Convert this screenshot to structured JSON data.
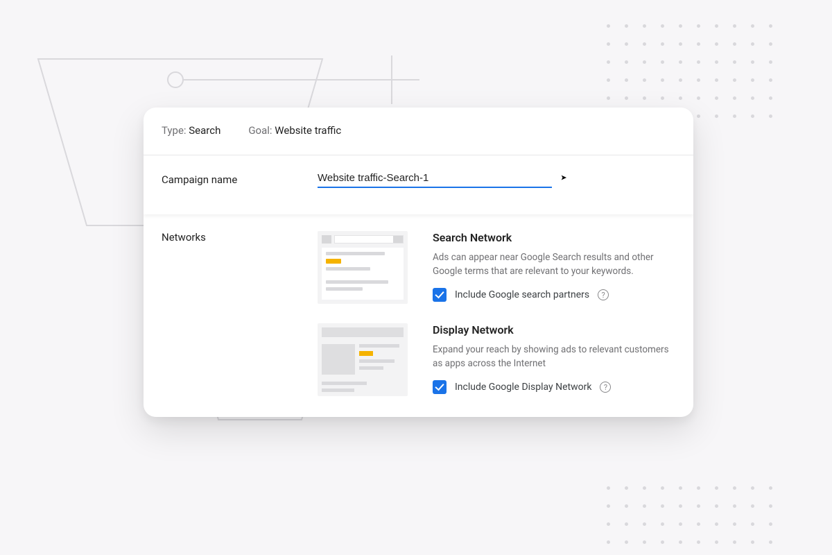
{
  "header": {
    "type_label": "Type:",
    "type_value": "Search",
    "goal_label": "Goal:",
    "goal_value": "Website traffic"
  },
  "campaign": {
    "label": "Campaign name",
    "value": "Website traffic-Search-1"
  },
  "networks": {
    "section_label": "Networks",
    "search": {
      "title": "Search Network",
      "desc": "Ads can appear near Google Search results and other Google terms that are relevant to your keywords.",
      "checkbox_label": "Include Google search partners",
      "checked": true
    },
    "display": {
      "title": "Display Network",
      "desc": "Expand your reach by showing ads to relevant customers as apps across the Internet",
      "checkbox_label": "Include Google Display Network",
      "checked": true
    }
  }
}
